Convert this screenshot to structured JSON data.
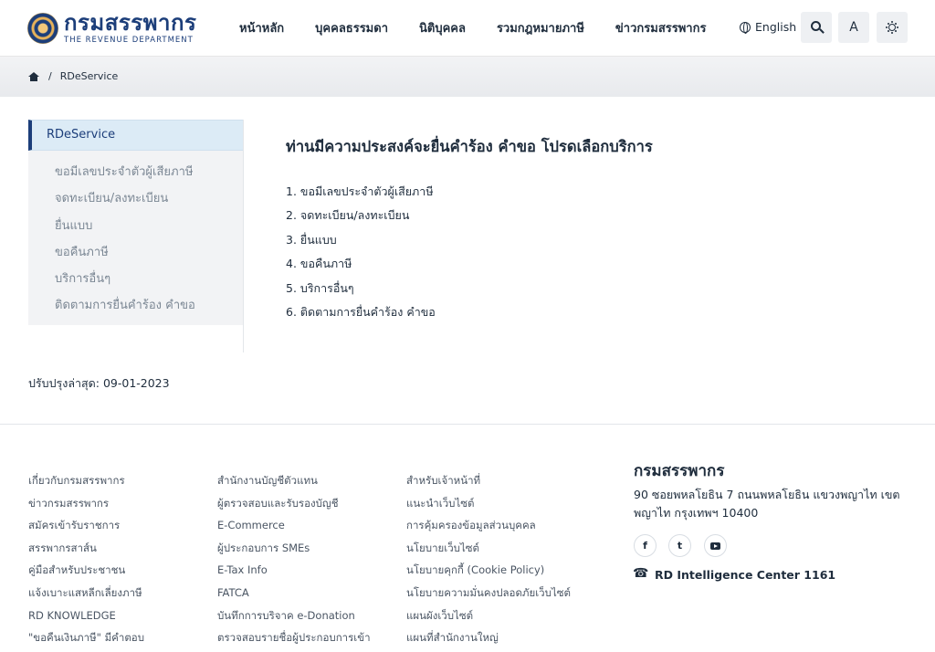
{
  "header": {
    "logo_th": "กรมสรรพากร",
    "logo_en": "THE REVENUE DEPARTMENT",
    "nav": [
      "หน้าหลัก",
      "บุคคลธรรมดา",
      "นิติบุคคล",
      "รวมกฎหมายภาษี",
      "ข่าวกรมสรรพากร"
    ],
    "language_label": "English",
    "font_button_label": "A"
  },
  "breadcrumb": {
    "current": "RDeService"
  },
  "sidebar": {
    "title": "RDeService",
    "items": [
      "ขอมีเลขประจำตัวผู้เสียภาษี",
      "จดทะเบียน/ลงทะเบียน",
      "ยื่นแบบ",
      "ขอคืนภาษี",
      "บริการอื่นๆ",
      "ติดตามการยื่นคำร้อง คำขอ"
    ]
  },
  "main": {
    "title": "ท่านมีความประสงค์จะยื่นคำร้อง คำขอ โปรดเลือกบริการ",
    "items": [
      "1. ขอมีเลขประจำตัวผู้เสียภาษี",
      "2. จดทะเบียน/ลงทะเบียน",
      "3. ยื่นแบบ",
      "4. ขอคืนภาษี",
      "5. บริการอื่นๆ",
      "6. ติดตามการยื่นคำร้อง คำขอ"
    ]
  },
  "updated": "ปรับปรุงล่าสุด: 09-01-2023",
  "footer": {
    "col1": [
      "เกี่ยวกับกรมสรรพากร",
      "ข่าวกรมสรรพากร",
      "สมัครเข้ารับราชการ",
      "สรรพากรสาส์น",
      "คู่มือสำหรับประชาชน",
      "แจ้งเบาะแสหลีกเลี่ยงภาษี",
      "RD KNOWLEDGE",
      "\"ขอคืนเงินภาษี\" มีคำตอบ"
    ],
    "col2": [
      "สำนักงานบัญชีตัวแทน",
      "ผู้ตรวจสอบและรับรองบัญชี",
      "E-Commerce",
      "ผู้ประกอบการ SMEs",
      "E-Tax Info",
      "FATCA",
      "บันทึกการบริจาค e-Donation",
      "ตรวจสอบรายชื่อผู้ประกอบการเข้า"
    ],
    "col3": [
      "สำหรับเจ้าหน้าที่",
      "แนะนำเว็บไซต์",
      "การคุ้มครองข้อมูลส่วนบุคคล",
      "นโยบายเว็บไซต์",
      "นโยบายคุกกี้ (Cookie Policy)",
      "นโยบายความมั่นคงปลอดภัยเว็บไซต์",
      "แผนผังเว็บไซต์",
      "แผนที่สำนักงานใหญ่"
    ],
    "org_name": "กรมสรรพากร",
    "address": "90 ซอยพหลโยธิน 7 ถนนพหลโยธิน แขวงพญาไท เขตพญาไท กรุงเทพฯ 10400",
    "social": {
      "facebook": "f",
      "twitter": "t"
    },
    "hotline": "RD Intelligence Center 1161"
  },
  "colors": {
    "brand": "#1c3e7a",
    "sidebar_active_bg": "#dcebf6",
    "sidebar_bg": "#f2f3f5",
    "breadcrumb_bg": "#eceef1"
  },
  "icons": [
    "globe-icon",
    "search-icon",
    "font-size-icon",
    "sun-icon",
    "home-icon",
    "facebook-icon",
    "twitter-icon",
    "youtube-icon",
    "phone-icon"
  ]
}
